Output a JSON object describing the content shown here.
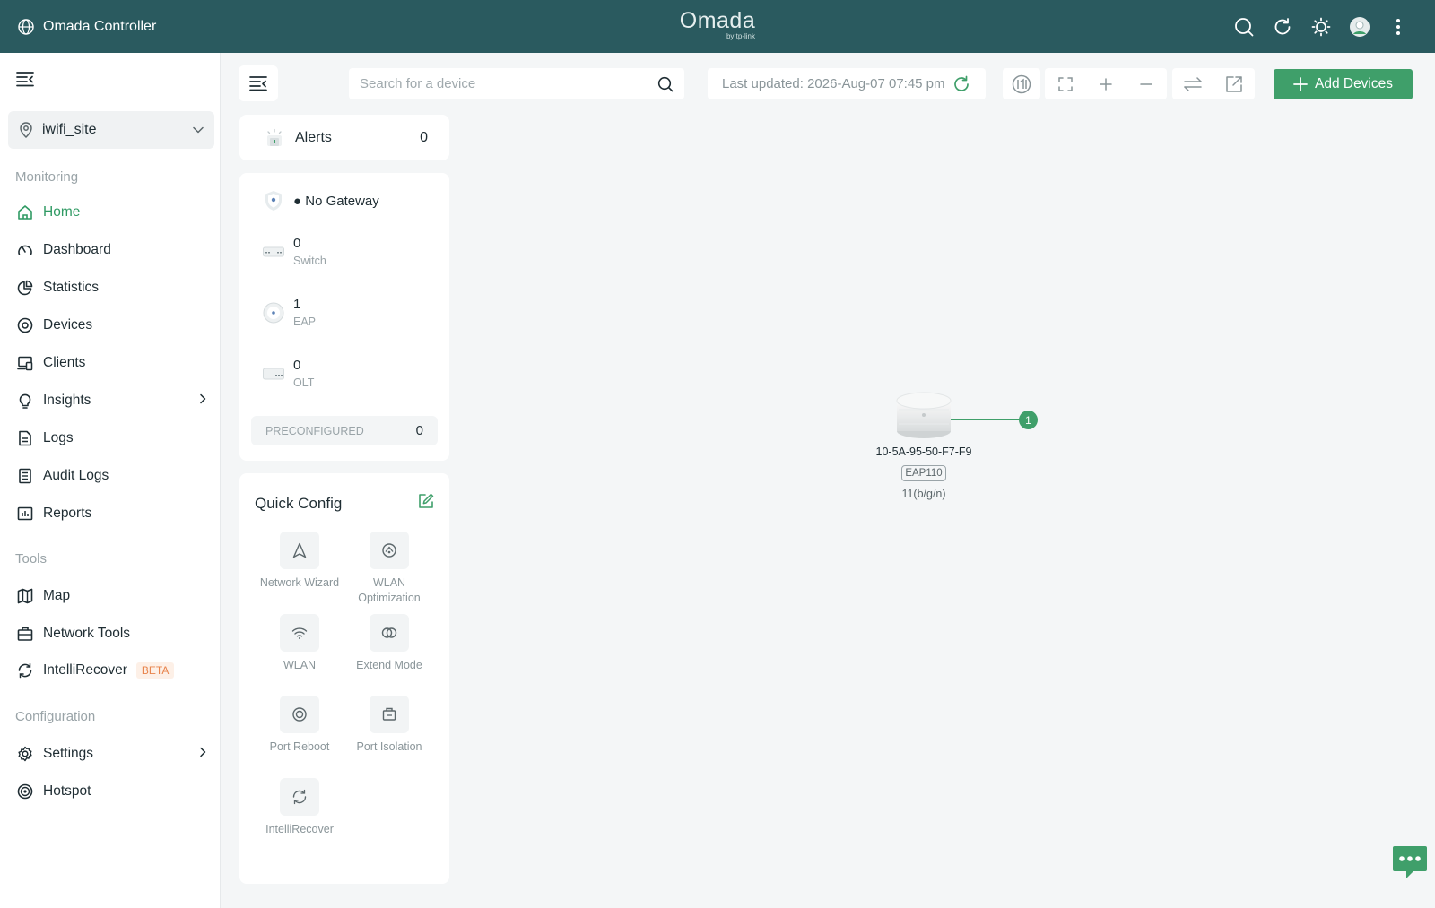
{
  "header": {
    "app_title": "Omada Controller",
    "logo": "Omada",
    "logo_sub": "by tp-link",
    "icons": [
      "search-icon",
      "refresh-icon",
      "theme-icon",
      "avatar",
      "more-icon"
    ]
  },
  "sidebar": {
    "site": "iwifi_site",
    "sections": {
      "monitoring": "Monitoring",
      "tools": "Tools",
      "configuration": "Configuration"
    },
    "items": [
      {
        "label": "Home",
        "icon": "home-icon",
        "active": true
      },
      {
        "label": "Dashboard",
        "icon": "dashboard-icon"
      },
      {
        "label": "Statistics",
        "icon": "statistics-icon"
      },
      {
        "label": "Devices",
        "icon": "devices-icon"
      },
      {
        "label": "Clients",
        "icon": "clients-icon"
      },
      {
        "label": "Insights",
        "icon": "insights-icon",
        "submenu": true
      },
      {
        "label": "Logs",
        "icon": "logs-icon"
      },
      {
        "label": "Audit Logs",
        "icon": "audit-logs-icon"
      },
      {
        "label": "Reports",
        "icon": "reports-icon"
      },
      {
        "label": "Map",
        "icon": "map-icon"
      },
      {
        "label": "Network Tools",
        "icon": "network-tools-icon"
      },
      {
        "label": "IntelliRecover",
        "icon": "intellirecover-icon",
        "badge": "BETA"
      },
      {
        "label": "Settings",
        "icon": "settings-icon",
        "submenu": true
      },
      {
        "label": "Hotspot",
        "icon": "hotspot-icon"
      }
    ]
  },
  "toolbar": {
    "search_placeholder": "Search for a device",
    "last_updated": "Last updated: 2026-Aug-07 07:45 pm",
    "add_devices": "Add Devices"
  },
  "alerts": {
    "label": "Alerts",
    "count": "0"
  },
  "devices": {
    "gateway": "No Gateway",
    "switch": {
      "count": "0",
      "label": "Switch"
    },
    "eap": {
      "count": "1",
      "label": "EAP"
    },
    "olt": {
      "count": "0",
      "label": "OLT"
    },
    "preconfigured": {
      "label": "PRECONFIGURED",
      "count": "0"
    }
  },
  "quick_config": {
    "title": "Quick Config",
    "items": [
      {
        "label": "Network Wizard",
        "icon": "network-wizard-icon"
      },
      {
        "label": "WLAN Optimization",
        "icon": "wlan-optimization-icon"
      },
      {
        "label": "WLAN",
        "icon": "wifi-icon"
      },
      {
        "label": "Extend Mode",
        "icon": "extend-mode-icon"
      },
      {
        "label": "Port Reboot",
        "icon": "port-reboot-icon"
      },
      {
        "label": "Port Isolation",
        "icon": "port-isolation-icon"
      },
      {
        "label": "IntelliRecover",
        "icon": "intellirecover-icon"
      }
    ]
  },
  "topology": {
    "device_name": "10-5A-95-50-F7-F9",
    "model": "EAP110",
    "radio": "11(b/g/n)",
    "client_count": "1"
  },
  "colors": {
    "header_bg": "#2a5a5f",
    "accent": "#3f9f6a",
    "active_nav": "#2f9a63",
    "beta": "#e8844c"
  }
}
